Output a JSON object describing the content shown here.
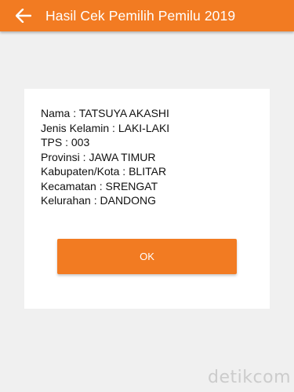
{
  "header": {
    "title": "Hasil Cek Pemilih Pemilu 2019",
    "back_icon": "arrow-left-icon"
  },
  "result": {
    "lines": [
      "Nama : TATSUYA AKASHI",
      "Jenis Kelamin : LAKI-LAKI",
      "TPS : 003",
      "Provinsi : JAWA TIMUR",
      "Kabupaten/Kota : BLITAR",
      "Kecamatan : SRENGAT",
      "Kelurahan : DANDONG"
    ]
  },
  "ok_label": "OK",
  "watermark": "detikcom",
  "colors": {
    "accent": "#f27b22",
    "background": "#f0f0f0",
    "card": "#ffffff"
  }
}
